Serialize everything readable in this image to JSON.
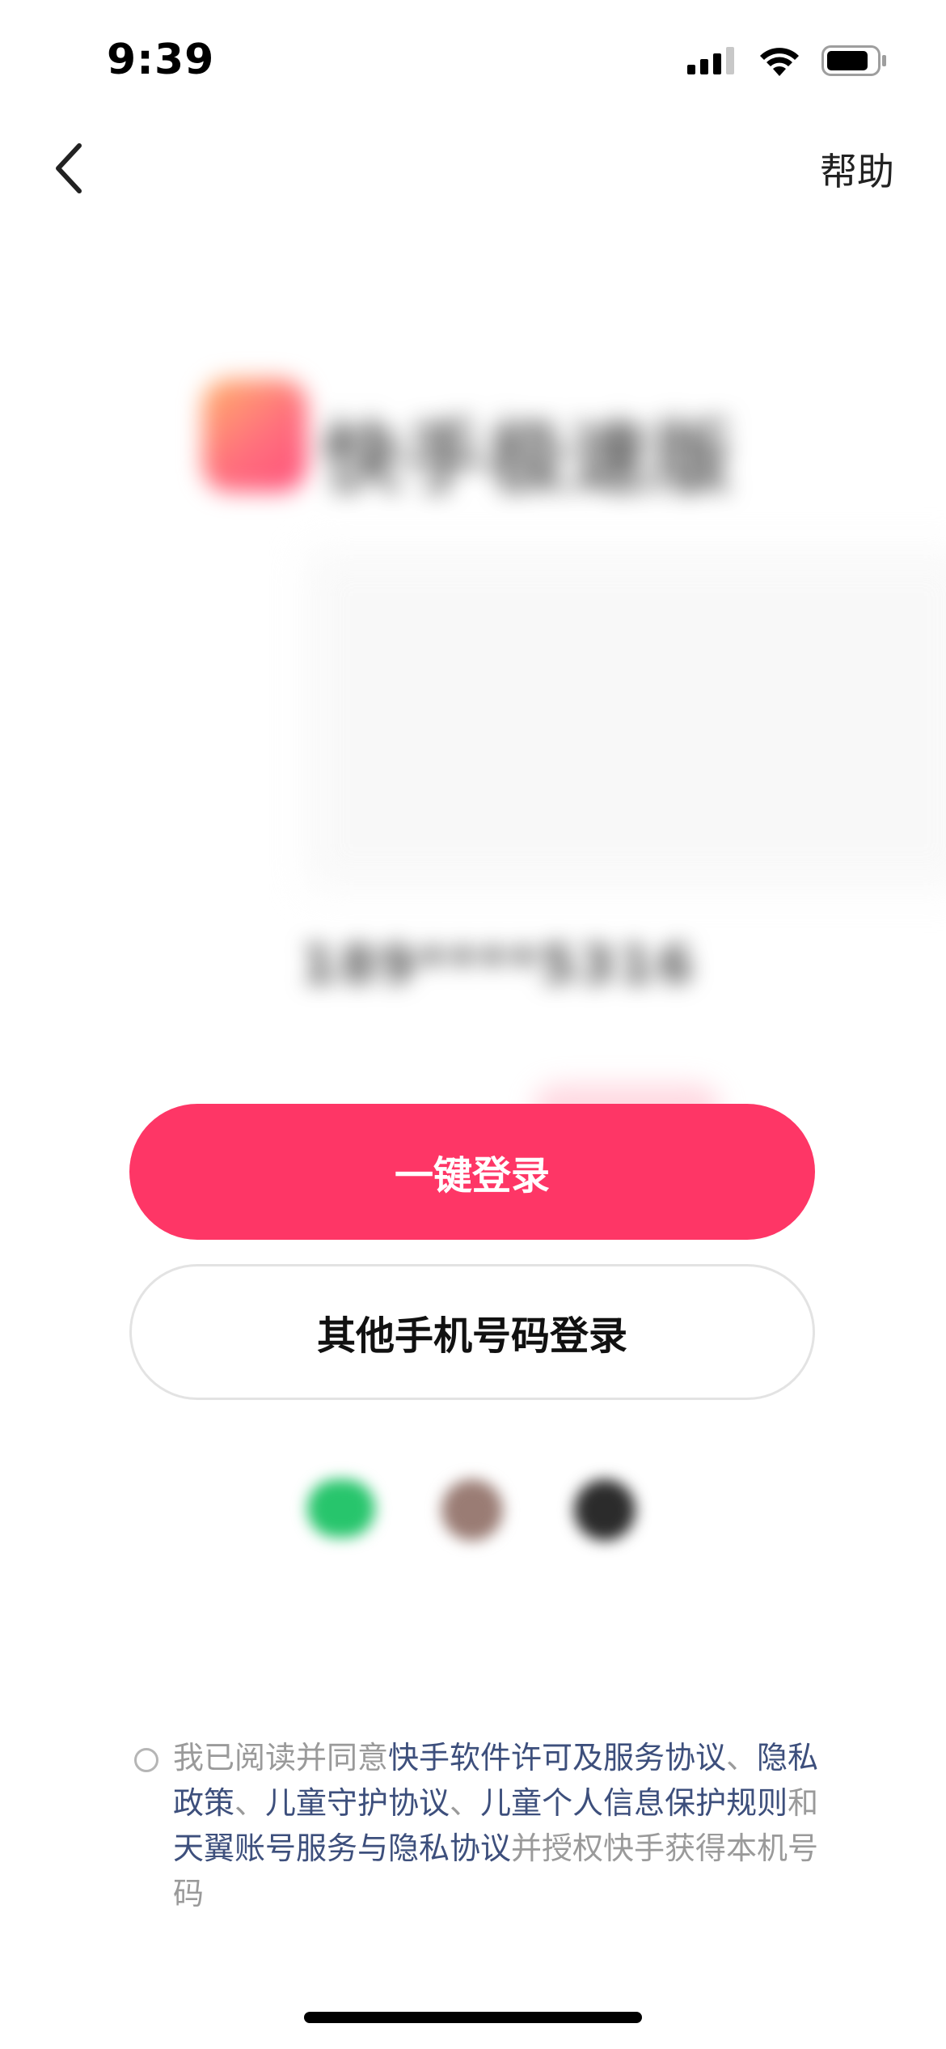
{
  "status_bar": {
    "time": "9:39"
  },
  "nav": {
    "help_label": "帮助"
  },
  "brand": {
    "name_blurred": "快手极速版"
  },
  "phone": {
    "masked_number": "189****5316"
  },
  "buttons": {
    "one_click_login": "一键登录",
    "other_phone_login": "其他手机号码登录"
  },
  "agreement": {
    "prefix": "我已阅读并同意",
    "link_1": "快手软件许可及服务协议",
    "sep_1": "、",
    "link_2": "隐私政策",
    "sep_2": "、",
    "link_3": "儿童守护协议",
    "sep_3": "、",
    "link_4": "儿童个人信息保护规则",
    "conj": "和",
    "link_5": "天翼账号服务与隐私协议",
    "suffix": "并授权快手获得本机号码"
  },
  "colors": {
    "primary": "#fe3666",
    "link": "#3d4f7c",
    "muted_text": "#9a9a9a"
  },
  "icons": [
    "signal-icon",
    "wifi-icon",
    "battery-icon",
    "back-chevron-icon",
    "wechat-login-icon",
    "avatar-login-icon",
    "apple-login-icon"
  ]
}
